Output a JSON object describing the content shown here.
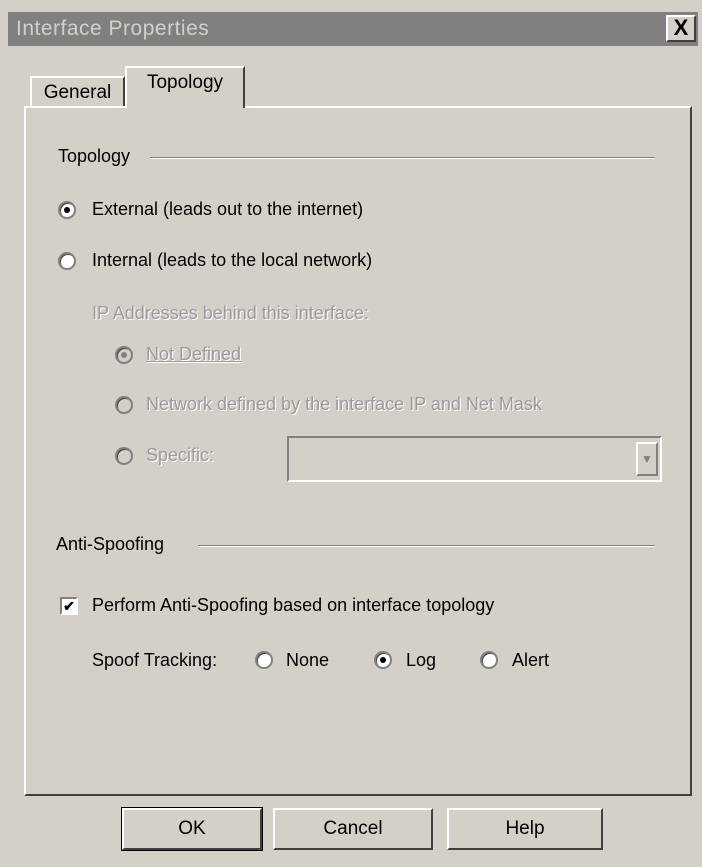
{
  "window": {
    "title": "Interface Properties",
    "close_label": "X"
  },
  "tabs": [
    {
      "label": "General",
      "selected": false
    },
    {
      "label": "Topology",
      "selected": true
    }
  ],
  "topology_group": {
    "label": "Topology",
    "external_label": "External (leads out to the internet)",
    "external_selected": true,
    "internal_label": "Internal (leads to the local network)",
    "internal_selected": false,
    "ip_addresses_label": "IP Addresses behind this interface:",
    "not_defined_label": "Not Defined",
    "network_defined_label": "Network defined by the interface IP and Net Mask",
    "specific_label": "Specific:",
    "specific_value": ""
  },
  "antispoof_group": {
    "label": "Anti-Spoofing",
    "perform_label": "Perform Anti-Spoofing based on interface topology",
    "perform_checked": true,
    "spoof_tracking_label": "Spoof Tracking:",
    "none_label": "None",
    "log_label": "Log",
    "alert_label": "Alert",
    "selected_tracking": "Log"
  },
  "buttons": {
    "ok_label": "OK",
    "cancel_label": "Cancel",
    "help_label": "Help"
  },
  "colors": {
    "face": "#d4d0c8",
    "title_bar": "#808080",
    "disabled_text": "#9a9a9a"
  }
}
